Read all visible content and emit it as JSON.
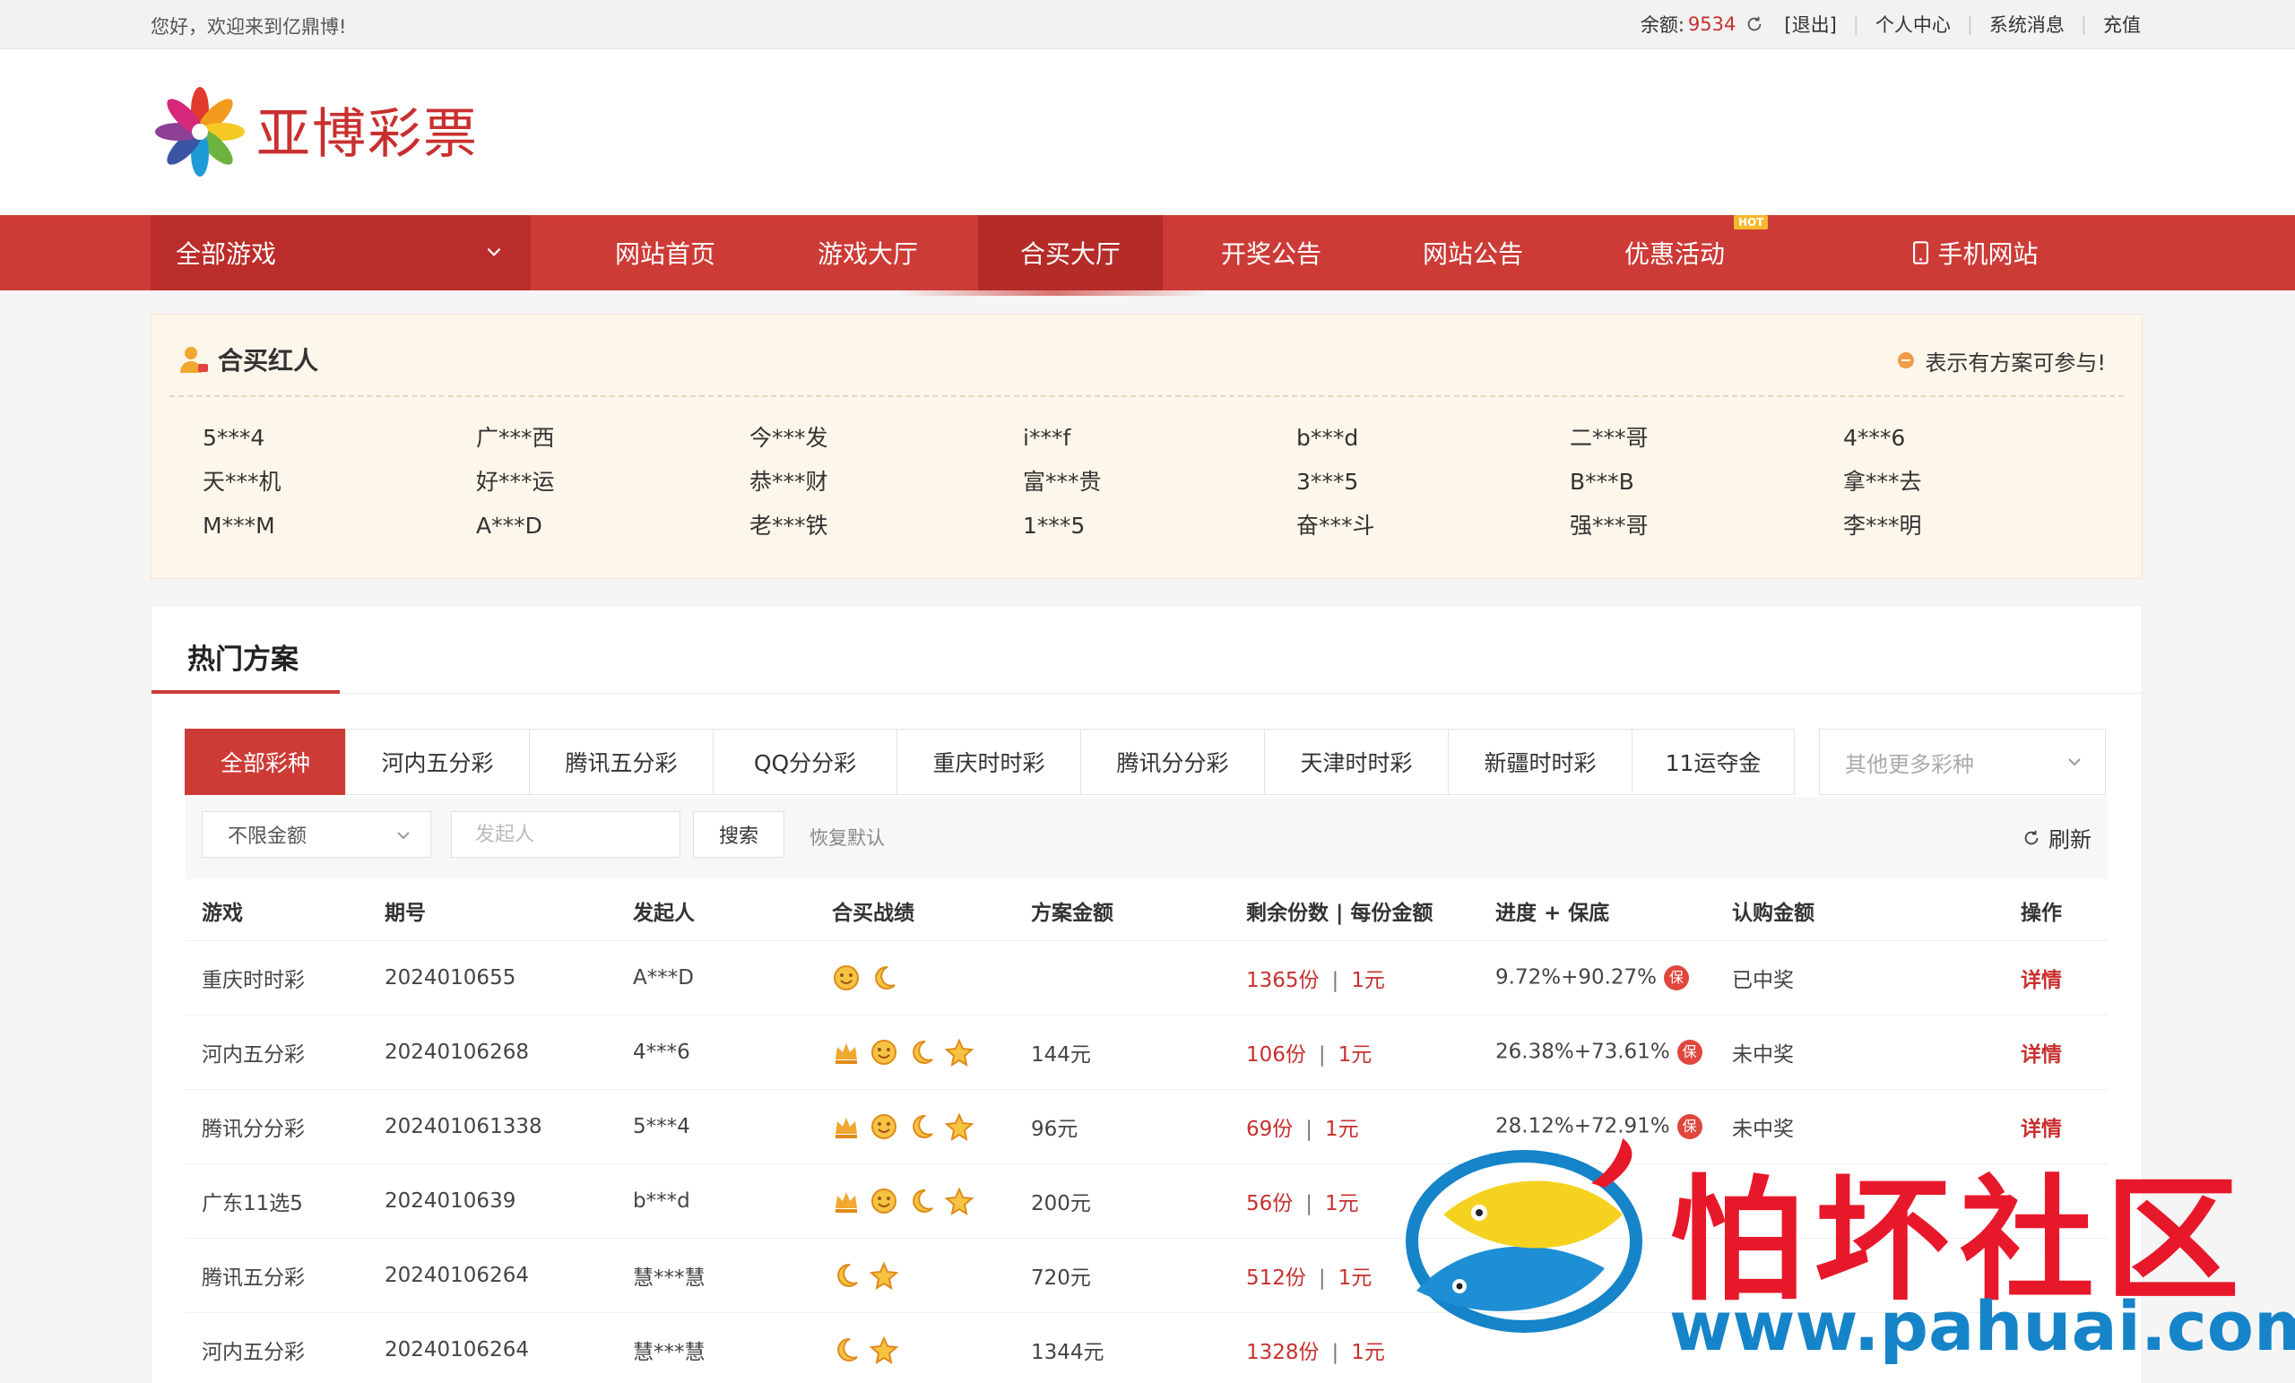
{
  "topbar": {
    "welcome": "您好，欢迎来到亿鼎博!",
    "balance_label": "余额:",
    "balance_value": "9534",
    "logout": "[退出]",
    "personal_center": "个人中心",
    "system_messages": "系统消息",
    "recharge": "充值"
  },
  "logo": {
    "text": "亚博彩票"
  },
  "nav": {
    "all_games": "全部游戏",
    "items": [
      "网站首页",
      "游戏大厅",
      "合买大厅",
      "开奖公告",
      "网站公告",
      "优惠活动",
      "手机网站"
    ],
    "active": "合买大厅",
    "hot_badge": "HOT"
  },
  "famous": {
    "title": "合买红人",
    "note": "表示有方案可参与!",
    "users": [
      "5***4",
      "广***西",
      "今***发",
      "i***f",
      "b***d",
      "二***哥",
      "4***6",
      "天***机",
      "好***运",
      "恭***财",
      "富***贵",
      "3***5",
      "B***B",
      "拿***去",
      "M***M",
      "A***D",
      "老***铁",
      "1***5",
      "奋***斗",
      "强***哥",
      "李***明"
    ]
  },
  "hot": {
    "title": "热门方案",
    "tabs": [
      "全部彩种",
      "河内五分彩",
      "腾讯五分彩",
      "QQ分分彩",
      "重庆时时彩",
      "腾讯分分彩",
      "天津时时彩",
      "新疆时时彩",
      "11运夺金"
    ],
    "more_select_placeholder": "其他更多彩种",
    "filter": {
      "amount_select": "不限金额",
      "initiator_placeholder": "发起人",
      "search": "搜索",
      "reset": "恢复默认",
      "refresh": "刷新"
    },
    "columns": [
      "游戏",
      "期号",
      "发起人",
      "合买战绩",
      "方案金额",
      "剩余份数 | 每份金额",
      "进度 + 保底",
      "认购金额",
      "操作"
    ],
    "rows": [
      {
        "game": "重庆时时彩",
        "issue": "2024010655",
        "initiator": "A***D",
        "badges": [
          "smile",
          "moon"
        ],
        "amount": "",
        "remaining": "1365份",
        "per": "1元",
        "progress": "9.72%+90.27%",
        "bao": "保",
        "status": "已中奖",
        "status_type": "won",
        "action": "详情"
      },
      {
        "game": "河内五分彩",
        "issue": "20240106268",
        "initiator": "4***6",
        "badges": [
          "crown",
          "smile",
          "moon",
          "star"
        ],
        "amount": "144元",
        "remaining": "106份",
        "per": "1元",
        "progress": "26.38%+73.61%",
        "bao": "保",
        "status": "未中奖",
        "status_type": "lost",
        "action": "详情"
      },
      {
        "game": "腾讯分分彩",
        "issue": "202401061338",
        "initiator": "5***4",
        "badges": [
          "crown",
          "smile",
          "moon",
          "star"
        ],
        "amount": "96元",
        "remaining": "69份",
        "per": "1元",
        "progress": "28.12%+72.91%",
        "bao": "保",
        "status": "未中奖",
        "status_type": "lost",
        "action": "详情"
      },
      {
        "game": "广东11选5",
        "issue": "2024010639",
        "initiator": "b***d",
        "badges": [
          "crown",
          "smile",
          "moon",
          "star"
        ],
        "amount": "200元",
        "remaining": "56份",
        "per": "1元",
        "progress": "",
        "bao": "",
        "status": "",
        "status_type": "lost",
        "action": ""
      },
      {
        "game": "腾讯五分彩",
        "issue": "20240106264",
        "initiator": "慧***慧",
        "badges": [
          "moon",
          "star"
        ],
        "amount": "720元",
        "remaining": "512份",
        "per": "1元",
        "progress": "",
        "bao": "",
        "status": "",
        "status_type": "lost",
        "action": ""
      },
      {
        "game": "河内五分彩",
        "issue": "20240106264",
        "initiator": "慧***慧",
        "badges": [
          "moon",
          "star"
        ],
        "amount": "1344元",
        "remaining": "1328份",
        "per": "1元",
        "progress": "",
        "bao": "",
        "status": "",
        "status_type": "lost",
        "action": ""
      }
    ]
  },
  "watermark": {
    "title": "怕坏社区",
    "url": "www.pahuai.com"
  },
  "colors": {
    "brand_red": "#cd3b37",
    "nav_dark": "#bb2d2a",
    "famous_bg": "#fdf6ea",
    "badge_gold": "#f0a830",
    "watermark_red": "#e8182b",
    "watermark_blue": "#1684c8"
  }
}
